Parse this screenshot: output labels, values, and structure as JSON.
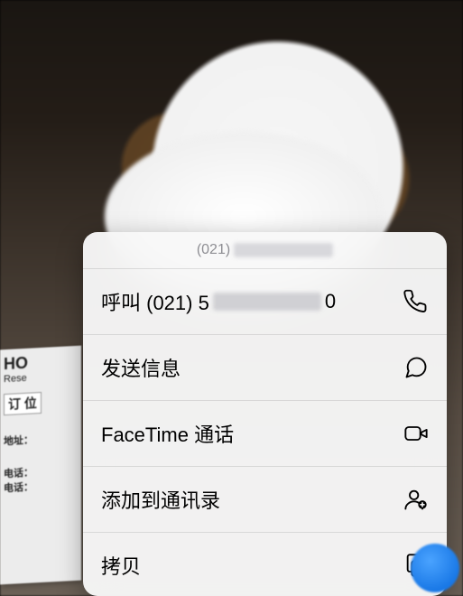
{
  "header": {
    "phone_prefix": "(021)",
    "phone_rest_masked": true
  },
  "menu": {
    "call": {
      "label_prefix": "呼叫 (021) 5",
      "label_masked_middle": true,
      "label_suffix": "0"
    },
    "message_label": "发送信息",
    "facetime_label": "FaceTime 通话",
    "add_contact_label": "添加到通讯录",
    "copy_label": "拷贝"
  },
  "background_card": {
    "line1_en": "HO",
    "line1_sub": "Rese",
    "line2_cn": "订 位",
    "addr_label": "地址：",
    "tel_label_1": "电话：",
    "tel_label_2": "电话："
  }
}
